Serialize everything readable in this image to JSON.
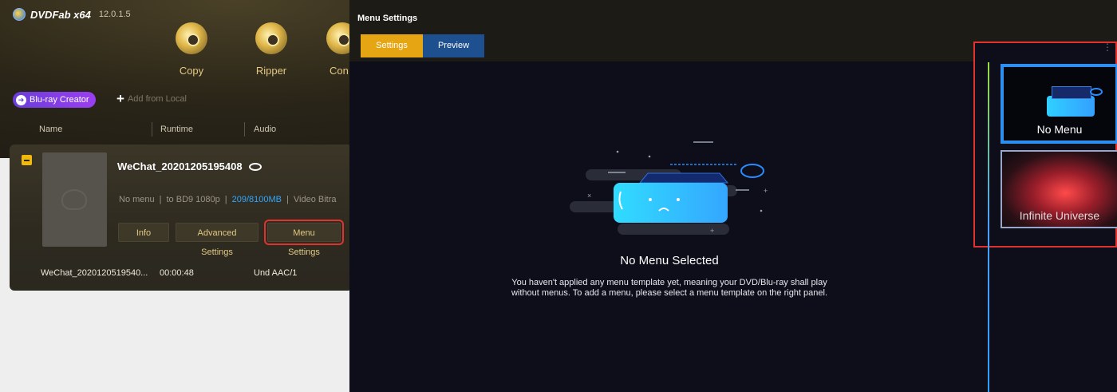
{
  "app": {
    "logo_text": "DVDFab x64",
    "version": "12.0.1.5",
    "modules": [
      {
        "label": "Copy"
      },
      {
        "label": "Ripper"
      },
      {
        "label": "Con"
      }
    ],
    "creator_label": "Blu-ray Creator",
    "add_local": "Add from Local",
    "columns": [
      "Name",
      "Runtime",
      "Audio"
    ],
    "card": {
      "title": "WeChat_20201205195408",
      "meta_menu": "No menu",
      "meta_target": "to BD9 1080p",
      "meta_size": "209/8100MB",
      "meta_bitrate": "Video Bitra",
      "buttons": {
        "info": "Info",
        "advanced": "Advanced Settings",
        "menu": "Menu Settings"
      },
      "row": {
        "name": "WeChat_2020120519540...",
        "runtime": "00:00:48",
        "audio": "Und AAC/1"
      }
    }
  },
  "overlay": {
    "title": "Menu Settings",
    "tabs": [
      {
        "label": "Settings",
        "active": true
      },
      {
        "label": "Preview",
        "active": false
      }
    ],
    "empty_title": "No Menu Selected",
    "empty_desc_1": "You haven't applied any menu template yet, meaning your DVD/Blu-ray shall play",
    "empty_desc_2": "without menus. To add a menu, please select a menu template on the right panel.",
    "templates": [
      {
        "label": "No Menu",
        "selected": true
      },
      {
        "label": "Infinite Universe",
        "selected": false
      }
    ]
  },
  "colors": {
    "accent": "#e6a512",
    "tab_blue": "#1e4f8e",
    "highlight_red": "#e0332f",
    "selection_blue": "#2d8ff0"
  }
}
